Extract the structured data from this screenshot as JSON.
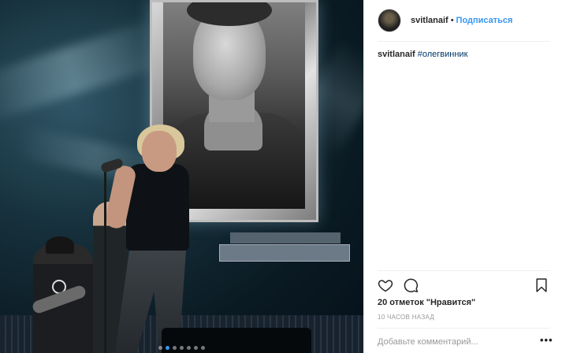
{
  "post": {
    "photo": {
      "alt_description": "",
      "carousel_dots": 7,
      "active_dot": 1
    },
    "header": {
      "username": "svitlanaif",
      "separator": "•",
      "follow_label": "Подписаться"
    },
    "caption": {
      "username": "svitlanaif",
      "hashtag": "#олегвинник"
    },
    "actions": {
      "like_icon": "heart-icon",
      "comment_icon": "comment-bubble-icon",
      "save_icon": "bookmark-icon"
    },
    "likes_text": "20 отметок \"Нравится\"",
    "timestamp": "10 ЧАСОВ НАЗАД",
    "comment_placeholder": "Добавьте комментарий...",
    "more_label": "•••"
  },
  "colors": {
    "accent": "#3897f0",
    "hashtag": "#003569",
    "text": "#262626",
    "muted": "#999999",
    "divider": "#efefef"
  }
}
